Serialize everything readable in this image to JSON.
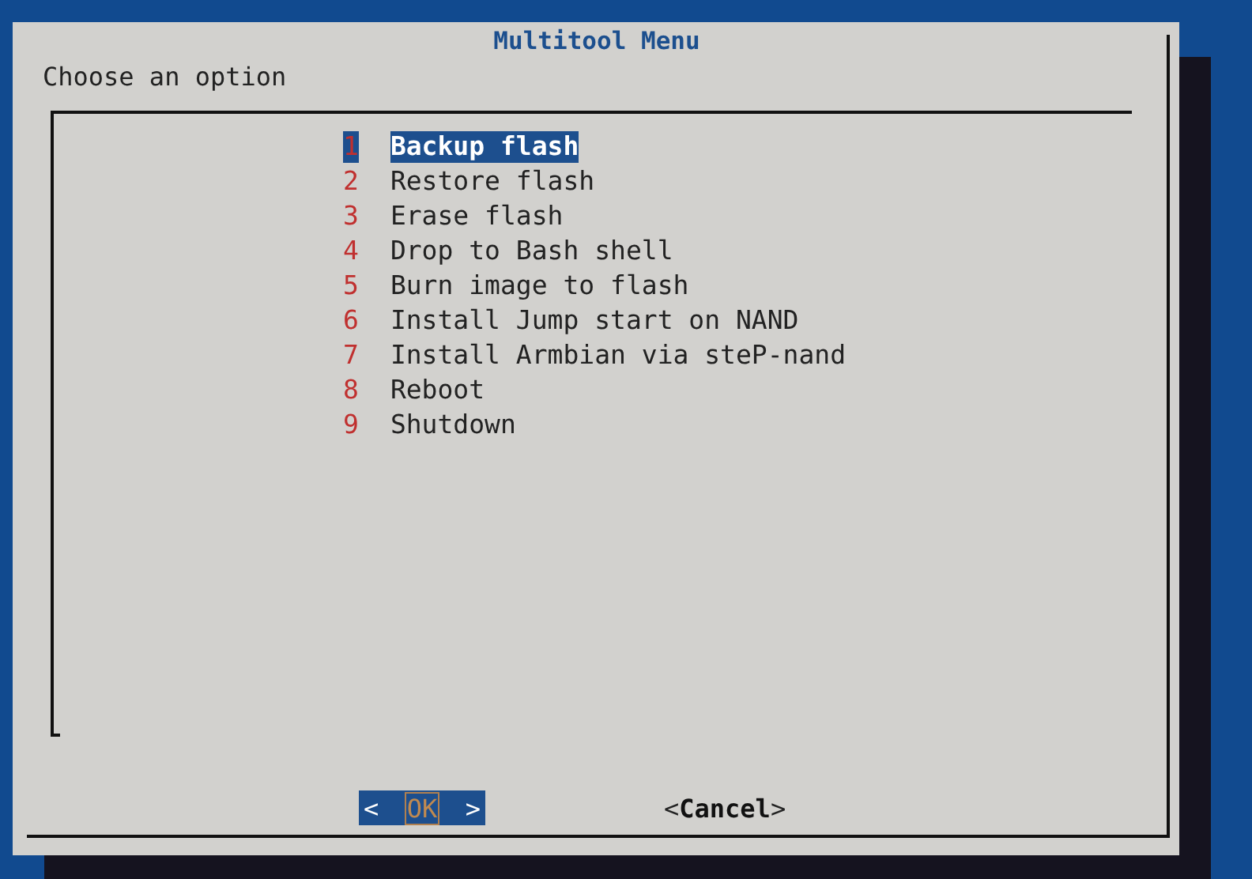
{
  "dialog": {
    "title": "Multitool Menu",
    "prompt": "Choose an option",
    "items": [
      {
        "tag": "1",
        "label": "Backup flash",
        "selected": true
      },
      {
        "tag": "2",
        "label": "Restore flash",
        "selected": false
      },
      {
        "tag": "3",
        "label": "Erase flash",
        "selected": false
      },
      {
        "tag": "4",
        "label": "Drop to Bash shell",
        "selected": false
      },
      {
        "tag": "5",
        "label": "Burn image to flash",
        "selected": false
      },
      {
        "tag": "6",
        "label": "Install Jump start on NAND",
        "selected": false
      },
      {
        "tag": "7",
        "label": "Install Armbian via steP-nand",
        "selected": false
      },
      {
        "tag": "8",
        "label": "Reboot",
        "selected": false
      },
      {
        "tag": "9",
        "label": "Shutdown",
        "selected": false
      }
    ],
    "buttons": [
      {
        "left": "<",
        "label": "OK",
        "right": ">",
        "selected": true
      },
      {
        "left": "<",
        "label": "Cancel",
        "right": ">",
        "selected": false
      }
    ]
  }
}
